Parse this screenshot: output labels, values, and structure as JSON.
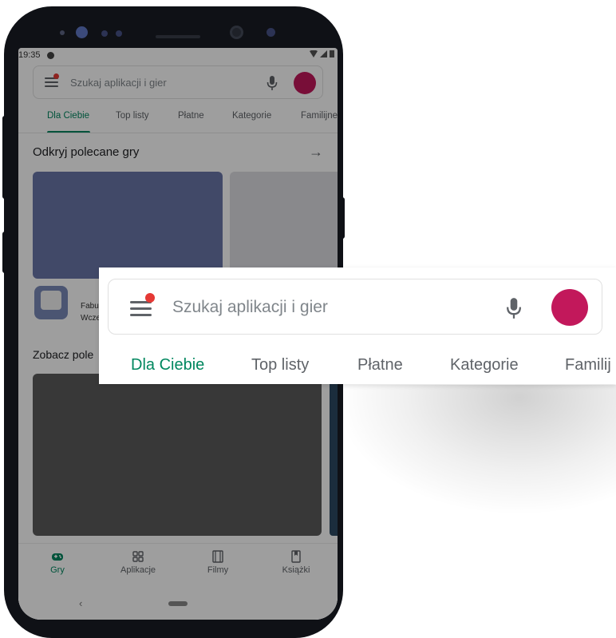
{
  "status_bar": {
    "time": "19:35"
  },
  "search": {
    "placeholder": "Szukaj aplikacji i gier"
  },
  "tabs": [
    {
      "label": "Dla Ciebie",
      "active": true
    },
    {
      "label": "Top listy"
    },
    {
      "label": "Płatne"
    },
    {
      "label": "Kategorie"
    },
    {
      "label": "Familijne"
    }
  ],
  "zoom_tabs": [
    {
      "label": "Dla Ciebie",
      "active": true
    },
    {
      "label": "Top listy"
    },
    {
      "label": "Płatne"
    },
    {
      "label": "Kategorie"
    },
    {
      "label": "Familij"
    }
  ],
  "sections": [
    {
      "title": "Odkryj polecane gry"
    },
    {
      "title": "Zobacz pole"
    }
  ],
  "featured_app": {
    "name_fragment": "Fabul",
    "subtitle_fragment": "Wczes"
  },
  "bottom_nav": [
    {
      "label": "Gry",
      "icon": "gamepad-icon",
      "active": true
    },
    {
      "label": "Aplikacje",
      "icon": "apps-grid-icon"
    },
    {
      "label": "Filmy",
      "icon": "film-icon"
    },
    {
      "label": "Książki",
      "icon": "book-icon"
    }
  ],
  "colors": {
    "accent_green": "#01875f",
    "avatar": "#c2185b",
    "notification_dot": "#e53935",
    "phone_frame": "#0f1116"
  }
}
